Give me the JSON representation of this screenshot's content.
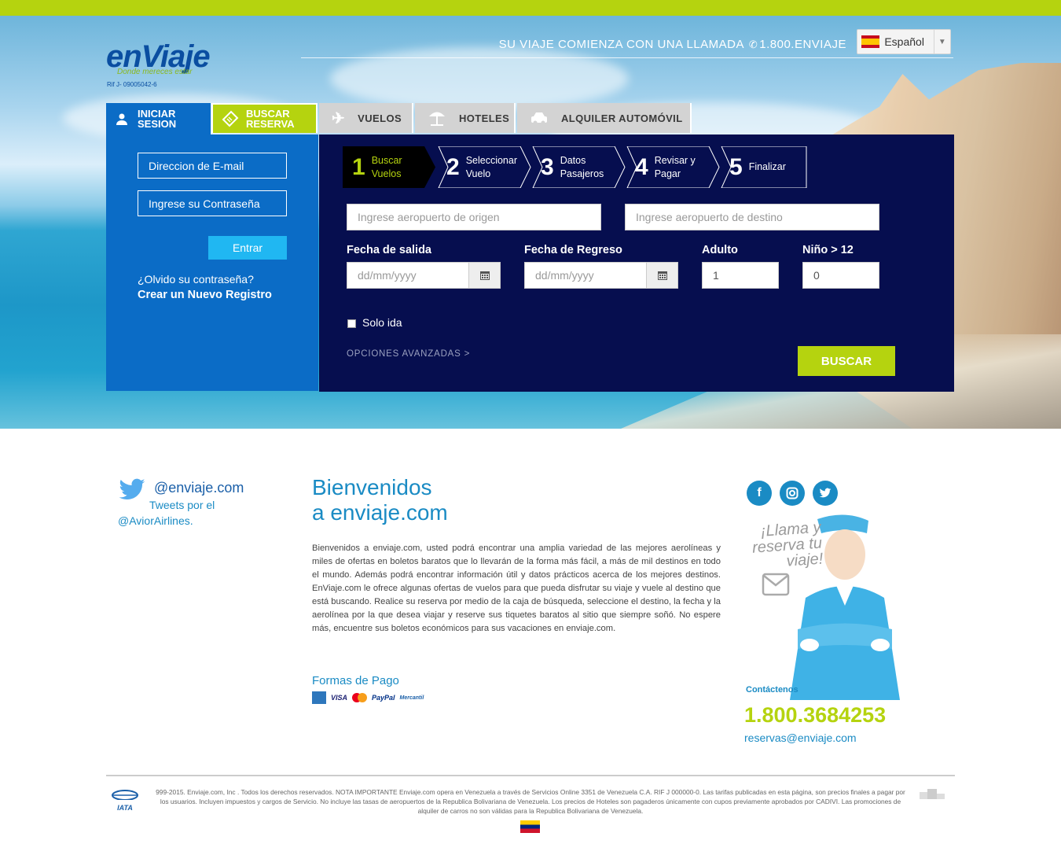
{
  "brand": {
    "logo": "enViaje",
    "tagline": "Donde mereces estar",
    "rif": "Rif J- 09005042-6"
  },
  "header": {
    "call_text": "SU VIAJE COMIENZA CON UNA LLAMADA",
    "call_number": "1.800.ENVIAJE",
    "language": "Español"
  },
  "tabs": {
    "login": "INICIAR SESION",
    "reserva": "BUSCAR RESERVA",
    "vuelos": "VUELOS",
    "hoteles": "HOTELES",
    "auto": "ALQUILER AUTOMÓVIL"
  },
  "login": {
    "email_placeholder": "Direccion de E-mail",
    "password_placeholder": "Ingrese su Contraseña",
    "submit": "Entrar",
    "forgot": "¿Olvido su contraseña?",
    "register": "Crear un Nuevo Registro"
  },
  "steps": [
    {
      "num": "1",
      "label": "Buscar Vuelos"
    },
    {
      "num": "2",
      "label": "Seleccionar Vuelo"
    },
    {
      "num": "3",
      "label": "Datos Pasajeros"
    },
    {
      "num": "4",
      "label": "Revisar y Pagar"
    },
    {
      "num": "5",
      "label": "Finalizar"
    }
  ],
  "search": {
    "origin_placeholder": "Ingrese aeropuerto de origen",
    "dest_placeholder": "Ingrese aeropuerto de destino",
    "salida_label": "Fecha de salida",
    "regreso_label": "Fecha de Regreso",
    "adulto_label": "Adulto",
    "nino_label": "Niño > 12",
    "date_placeholder": "dd/mm/yyyy",
    "adulto_value": "1",
    "nino_value": "0",
    "solo_ida": "Solo ida",
    "advanced": "OPCIONES AVANZADAS >",
    "submit": "BUSCAR"
  },
  "twitter": {
    "handle": "@enviaje.com",
    "tweets_by": "Tweets por el",
    "account": "@AviorAirlines."
  },
  "welcome": {
    "title_line1": "Bienvenidos",
    "title_line2": "a enviaje.com",
    "body": "Bienvenidos a enviaje.com, usted podrá encontrar una amplia variedad de las mejores aerolíneas y miles de ofertas en boletos baratos que lo llevarán de la forma más fácil, a más de mil destinos en todo el mundo. Además podrá encontrar información útil y datos prácticos acerca de los mejores destinos. EnViaje.com le ofrece algunas ofertas de vuelos para que pueda disfrutar su viaje y vuele al destino que está buscando. Realice su reserva por medio de la caja de búsqueda, seleccione el destino, la fecha y la aerolínea por la que desea viajar y reserve sus tiquetes baratos al sitio que siempre soñó. No espere más, encuentre sus boletos económicos para sus vacaciones en enviaje.com.",
    "payment_title": "Formas de Pago",
    "payment_methods": [
      "VISA",
      "PayPal",
      "Mercantil"
    ]
  },
  "contact": {
    "promo": "¡Llama y reserva tu viaje!",
    "label": "Contáctenos",
    "phone": "1.800.3684253",
    "email": "reservas@enviaje.com"
  },
  "footer": {
    "iata": "IATA",
    "legal": "999-2015. Enviaje.com, Inc . Todos los derechos reservados. NOTA IMPORTANTE Enviaje.com opera en Venezuela a través de Servicios Online 3351 de Venezuela C.A. RIF J 000000-0. Las tarifas publicadas en esta página, son precios finales a pagar por los usuarios. Incluyen impuestos y cargos de Servicio. No incluye las tasas de aeropuertos de la Republica Bolivariana de Venezuela. Los precios de Hoteles son pagaderos únicamente con cupos previamente aprobados por CADIVI. Las promociones de alquiler de carros no son válidas para la Republica Bolivariana de Venezuela."
  },
  "colors": {
    "lime": "#b5d30f",
    "blue": "#0b6cc6",
    "navy": "#060e4f",
    "link": "#1a8bc4"
  }
}
